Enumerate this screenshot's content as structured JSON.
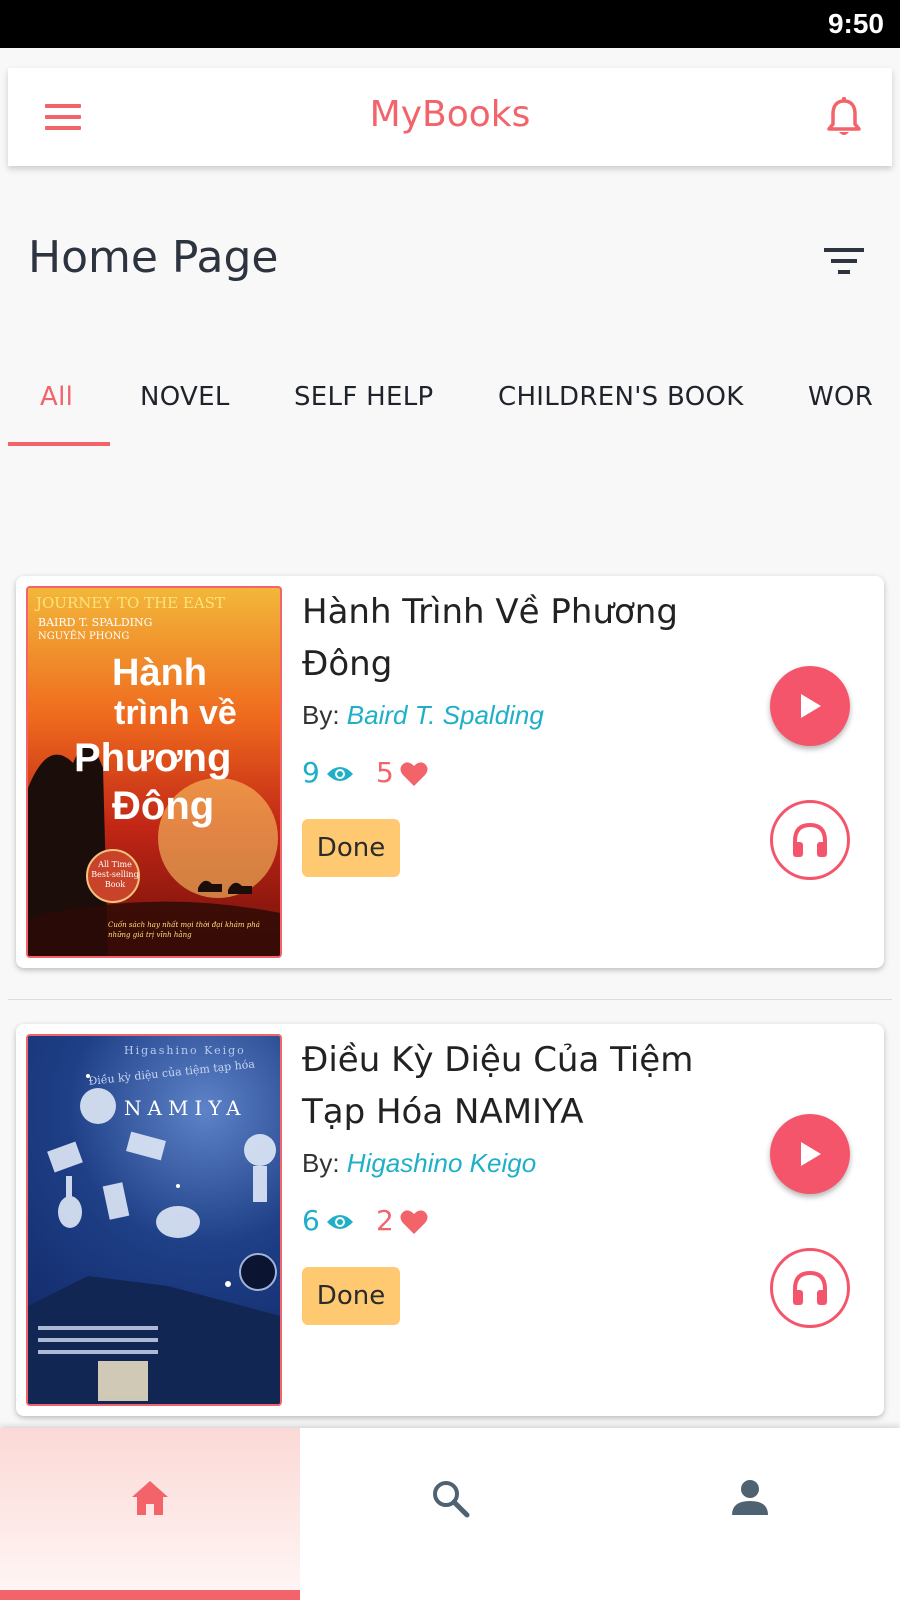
{
  "status_bar": {
    "time": "9:50"
  },
  "app_bar": {
    "title": "MyBooks",
    "menu_icon": "menu-icon",
    "notification_icon": "bell-icon"
  },
  "page": {
    "title": "Home Page",
    "filter_icon": "filter-icon"
  },
  "tabs": [
    {
      "label": "All",
      "active": true
    },
    {
      "label": "NOVEL",
      "active": false
    },
    {
      "label": "SELF HELP",
      "active": false
    },
    {
      "label": "CHILDREN'S BOOK",
      "active": false
    },
    {
      "label": "WOR",
      "active": false
    }
  ],
  "books": [
    {
      "title": "Hành Trình Về Phương Đông",
      "by_label": "By: ",
      "author": "Baird T. Spalding",
      "views": "9",
      "likes": "5",
      "status": "Done",
      "cover": {
        "top_line": "JOURNEY TO THE EAST",
        "authors": "BAIRD T. SPALDING",
        "translator": "NGUYÊN PHONG",
        "title_l1": "Hành",
        "title_l2": "trình về",
        "title_l3": "Phương",
        "title_l4": "Đông",
        "seal": "All Time Best-selling Book",
        "tagline": "Cuốn sách hay nhất mọi thời đại khám phá những giá trị vĩnh hằng"
      }
    },
    {
      "title": "Điều Kỳ Diệu Của Tiệm Tạp Hóa NAMIYA",
      "by_label": "By: ",
      "author": "Higashino Keigo",
      "views": "6",
      "likes": "2",
      "status": "Done",
      "cover": {
        "author": "Higashino Keigo",
        "subtitle": "Điều kỳ diệu của tiệm tạp hóa",
        "title": "NAMIYA"
      }
    }
  ],
  "bottom_nav": [
    {
      "name": "home",
      "icon": "home-icon",
      "active": true
    },
    {
      "name": "search",
      "icon": "search-icon",
      "active": false
    },
    {
      "name": "profile",
      "icon": "person-icon",
      "active": false
    }
  ],
  "colors": {
    "accent": "#f2636a",
    "author_link": "#1fb0c8",
    "badge": "#ffc972",
    "play_button": "#f5556a"
  }
}
